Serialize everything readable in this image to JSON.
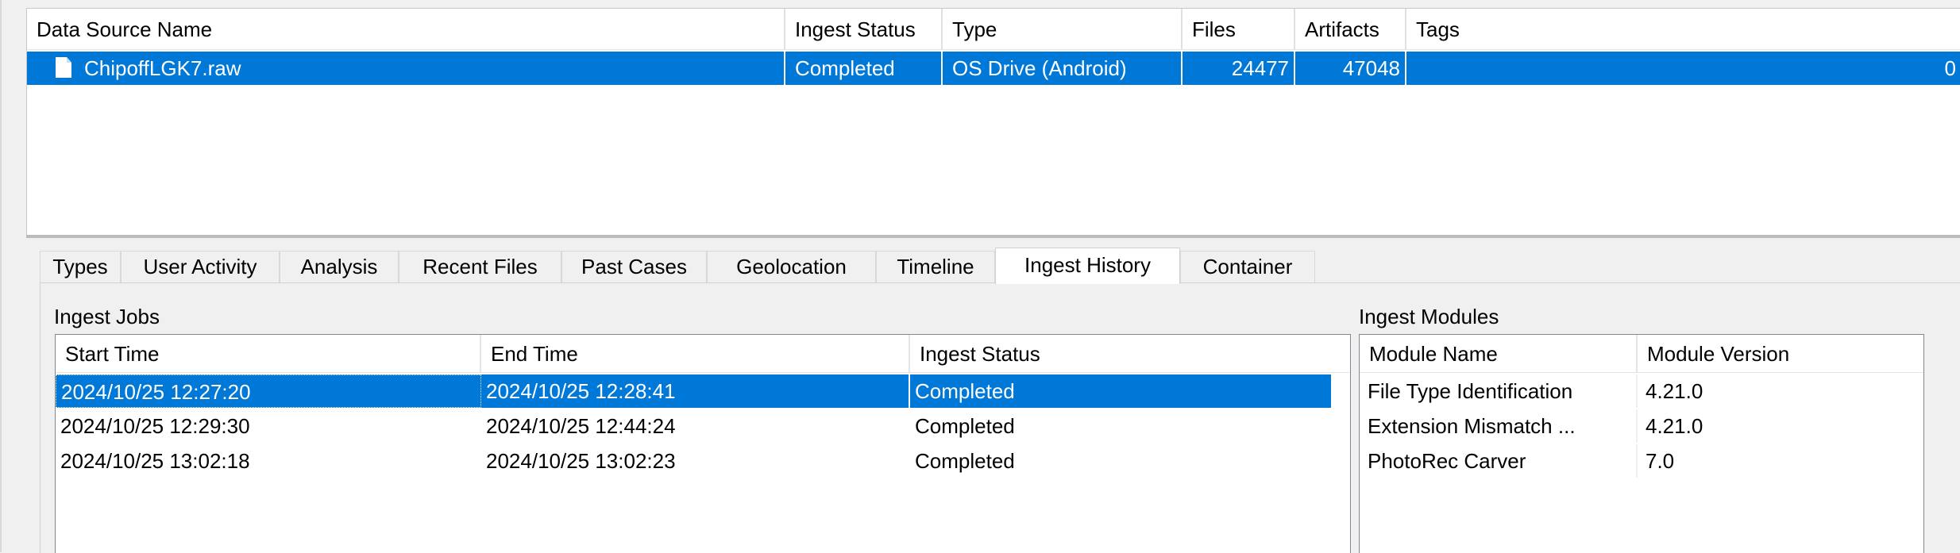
{
  "data_sources": {
    "columns": [
      "Data Source Name",
      "Ingest Status",
      "Type",
      "Files",
      "Artifacts",
      "Tags"
    ],
    "rows": [
      {
        "icon": "file-icon",
        "name": "ChipoffLGK7.raw",
        "ingest_status": "Completed",
        "type": "OS Drive (Android)",
        "files": "24477",
        "artifacts": "47048",
        "tags": "0",
        "selected": true
      }
    ]
  },
  "tabs": [
    "Types",
    "User Activity",
    "Analysis",
    "Recent Files",
    "Past Cases",
    "Geolocation",
    "Timeline",
    "Ingest History",
    "Container"
  ],
  "active_tab": "Ingest History",
  "ingest_jobs": {
    "label": "Ingest Jobs",
    "columns": [
      "Start Time",
      "End Time",
      "Ingest Status"
    ],
    "rows": [
      {
        "start": "2024/10/25 12:27:20",
        "end": "2024/10/25 12:28:41",
        "status": "Completed",
        "selected": true
      },
      {
        "start": "2024/10/25 12:29:30",
        "end": "2024/10/25 12:44:24",
        "status": "Completed",
        "selected": false
      },
      {
        "start": "2024/10/25 13:02:18",
        "end": "2024/10/25 13:02:23",
        "status": "Completed",
        "selected": false
      }
    ]
  },
  "ingest_modules": {
    "label": "Ingest Modules",
    "columns": [
      "Module Name",
      "Module Version"
    ],
    "rows": [
      {
        "name": "File Type Identification",
        "version": "4.21.0"
      },
      {
        "name": "Extension Mismatch ...",
        "version": "4.21.0"
      },
      {
        "name": "PhotoRec Carver",
        "version": "7.0"
      }
    ]
  },
  "colors": {
    "selection": "#0078d7",
    "panel_bg": "#f0f0f0",
    "grid_border": "#828790"
  }
}
